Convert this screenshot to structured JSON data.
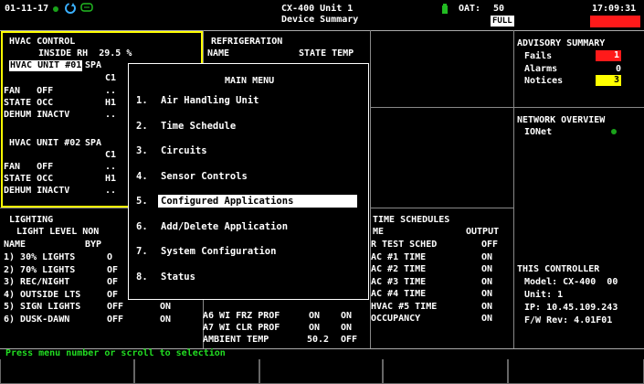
{
  "topbar": {
    "date": "01-11-17",
    "title_line1": "CX-400 Unit 1",
    "title_line2": "Device Summary",
    "oat_label": "OAT:",
    "oat_value": "50",
    "mode_badge": "FULL",
    "time": "17:09:31"
  },
  "hvac": {
    "header": "HVAC CONTROL",
    "inside_rh": "INSIDE RH  29.5 %",
    "unit1_label": "HVAC UNIT #01",
    "unit1_spa": "SPA",
    "unit1_c1": "C1",
    "unit1_fan": "FAN   OFF",
    "unit1_fan_v": "..",
    "unit1_state": "STATE OCC",
    "unit1_state_v": "H1",
    "unit1_dehum": "DEHUM INACTV",
    "unit1_dehum_v": "..",
    "unit2_label": "HVAC UNIT #02",
    "unit2_spa": "SPA",
    "unit2_c1": "C1",
    "unit2_fan": "FAN   OFF",
    "unit2_fan_v": "..",
    "unit2_state": "STATE OCC",
    "unit2_state_v": "H1",
    "unit2_dehum": "DEHUM INACTV",
    "unit2_dehum_v": ".."
  },
  "refrigeration": {
    "header": "REFRIGERATION",
    "col_name": "NAME",
    "col_state_temp": "STATE TEMP",
    "rows": [
      {
        "name": "A6 WI FRZ PROF",
        "state": "ON",
        "temp": "ON"
      },
      {
        "name": "A7 WI CLR PROF",
        "state": "ON",
        "temp": "ON"
      },
      {
        "name": "AMBIENT TEMP",
        "state": "50.2",
        "temp": "OFF"
      }
    ]
  },
  "lighting": {
    "header": "LIGHTING",
    "sub": "LIGHT LEVEL NON",
    "col_name": "NAME",
    "col_byp": "BYP",
    "rows": [
      {
        "name": "1) 30% LIGHTS",
        "v1": "O",
        "v2": ""
      },
      {
        "name": "2) 70% LIGHTS",
        "v1": "OF",
        "v2": ""
      },
      {
        "name": "3) REC/NIGHT",
        "v1": "OF",
        "v2": ""
      },
      {
        "name": "4) OUTSIDE LTS",
        "v1": "OF",
        "v2": ""
      },
      {
        "name": "5) SIGN LIGHTS",
        "v1": "OFF",
        "v2": "ON"
      },
      {
        "name": "6) DUSK-DAWN",
        "v1": "OFF",
        "v2": "ON"
      }
    ]
  },
  "time_schedules": {
    "header": "TIME SCHEDULES",
    "col_name": "ME",
    "col_output": "OUTPUT",
    "rows": [
      {
        "name": "R TEST SCHED",
        "out": "OFF"
      },
      {
        "name": "AC #1 TIME",
        "out": "ON"
      },
      {
        "name": "AC #2 TIME",
        "out": "ON"
      },
      {
        "name": "AC #3 TIME",
        "out": "ON"
      },
      {
        "name": "AC #4 TIME",
        "out": "ON"
      },
      {
        "name": "HVAC #5 TIME",
        "out": "ON"
      },
      {
        "name": "OCCUPANCY",
        "out": "ON"
      }
    ]
  },
  "advisory": {
    "header": "ADVISORY SUMMARY",
    "fails_label": "Fails",
    "fails_value": "1",
    "alarms_label": "Alarms",
    "alarms_value": "0",
    "notices_label": "Notices",
    "notices_value": "3"
  },
  "network": {
    "header": "NETWORK OVERVIEW",
    "ionet": "IONet"
  },
  "controller": {
    "header": "THIS CONTROLLER",
    "model": "Model: CX-400  00",
    "unit": "Unit: 1",
    "ip": "IP: 10.45.109.243",
    "fw": "F/W Rev: 4.01F01"
  },
  "menu": {
    "title": "MAIN MENU",
    "items": [
      {
        "num": "1.",
        "label": "Air Handling Unit"
      },
      {
        "num": "2.",
        "label": "Time Schedule"
      },
      {
        "num": "3.",
        "label": "Circuits"
      },
      {
        "num": "4.",
        "label": "Sensor Controls"
      },
      {
        "num": "5.",
        "label": "Configured Applications"
      },
      {
        "num": "6.",
        "label": "Add/Delete Application"
      },
      {
        "num": "7.",
        "label": "System Configuration"
      },
      {
        "num": "8.",
        "label": "Status"
      }
    ],
    "selected_index": 5
  },
  "status_line": "Press menu number or scroll to selection",
  "icons": [
    "status-dot-icon",
    "refresh-icon",
    "monitor-icon",
    "battery-icon",
    "network-status-icon"
  ],
  "colors": {
    "accent_yellow": "#ffff00",
    "fail_red": "#ff1a1a",
    "ok_green": "#1aa31a",
    "prompt_green": "#22dd22"
  }
}
